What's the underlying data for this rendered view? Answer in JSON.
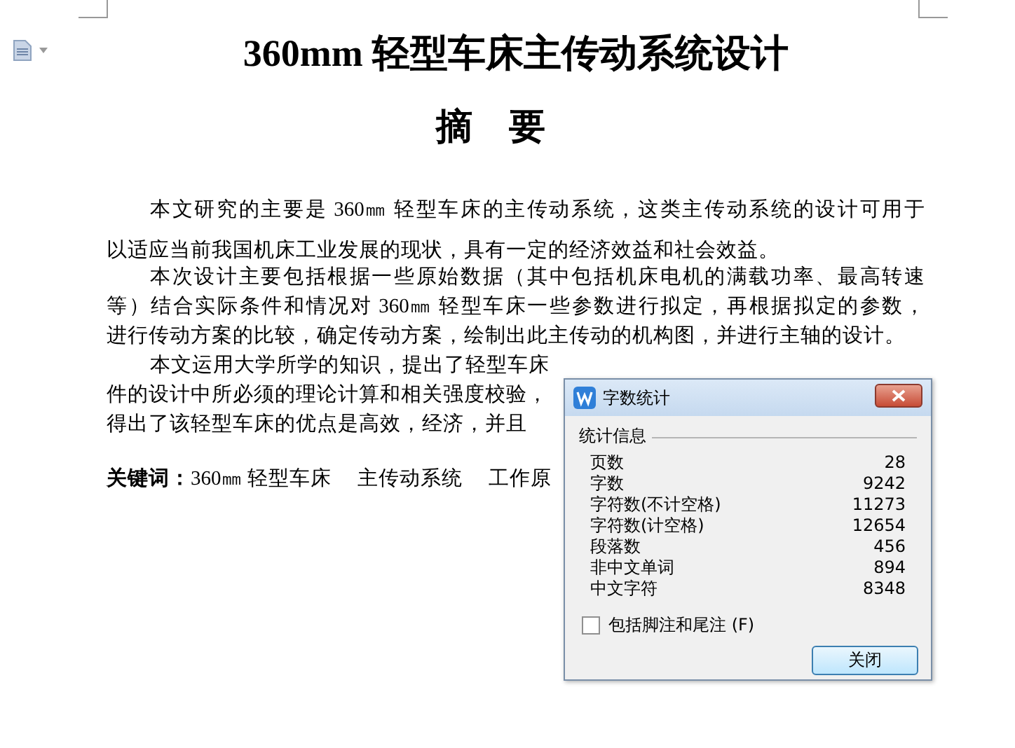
{
  "document": {
    "title": "360mm 轻型车床主传动系统设计",
    "heading": "摘　要",
    "paragraphs": [
      {
        "kind": "justified",
        "lines": [
          "本文研究的主要是 360㎜ 轻型车床的主传动系统，这类主传动系统的设计可用于",
          "以适应当前我国机床工业发展的现状，具有一定的经济效益和社会效益。"
        ]
      },
      {
        "kind": "justified",
        "lines": [
          "本次设计主要包括根据一些原始数据（其中包括机床电机的满载功率、最高转速",
          "等）结合实际条件和情况对 360㎜ 轻型车床一些参数进行拟定，再根据拟定的参数，",
          "进行传动方案的比较，确定传动方案，绘制出此主传动的机构图，并进行主轴的设计。"
        ]
      },
      {
        "kind": "cut",
        "lines": [
          "本文运用大学所学的知识，提出了轻型车床",
          "件的设计中所必须的理论计算和相关强度校验，",
          "得出了该轻型车床的优点是高效，经济，并且"
        ]
      }
    ],
    "keywords": {
      "label": "关键词：",
      "terms": "360㎜ 轻型车床　 主传动系统　 工作原"
    }
  },
  "dialog": {
    "title": "字数统计",
    "section": "统计信息",
    "stats": [
      {
        "label": "页数",
        "value": "28"
      },
      {
        "label": "字数",
        "value": "9242"
      },
      {
        "label": "字符数(不计空格)",
        "value": "11273"
      },
      {
        "label": "字符数(计空格)",
        "value": "12654"
      },
      {
        "label": "段落数",
        "value": "456"
      },
      {
        "label": "非中文单词",
        "value": "894"
      },
      {
        "label": "中文字符",
        "value": "8348"
      }
    ],
    "checkbox": {
      "label": "包括脚注和尾注 (F)",
      "checked": false
    },
    "button": "关闭"
  }
}
